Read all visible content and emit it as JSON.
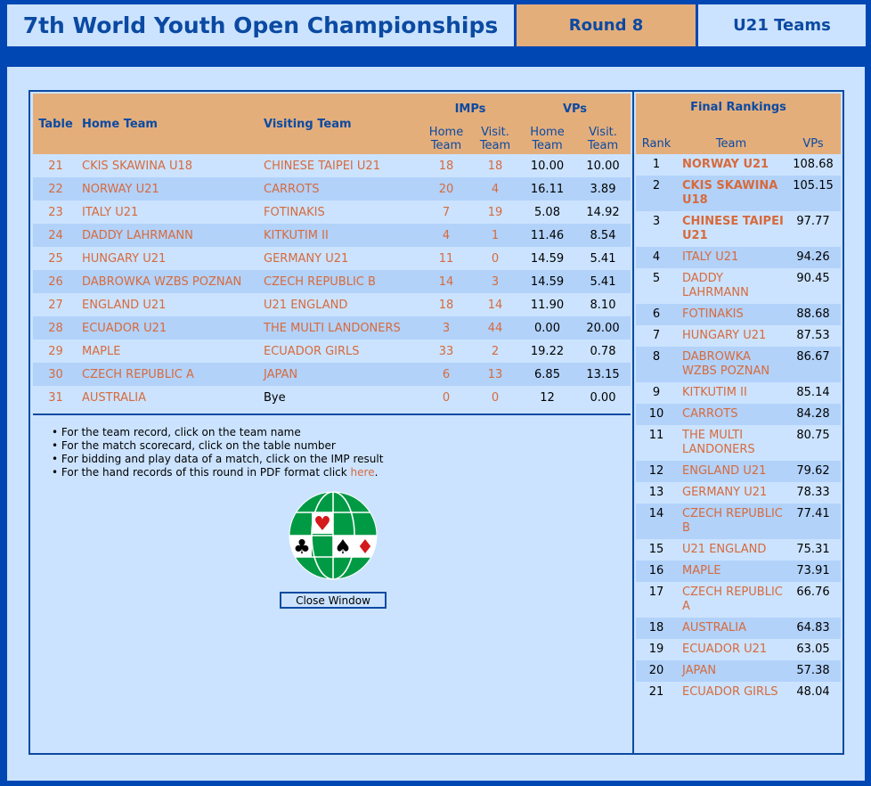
{
  "header": {
    "title": "7th World Youth Open Championships",
    "round": "Round 8",
    "category": "U21 Teams"
  },
  "results": {
    "headers": {
      "table": "Table",
      "home_team": "Home Team",
      "visiting_team": "Visiting Team",
      "imps": "IMPs",
      "vps": "VPs",
      "home_line1": "Home",
      "home_line2": "Team",
      "visit_line1": "Visit.",
      "visit_line2": "Team"
    },
    "rows": [
      {
        "table": "21",
        "home": "CKIS SKAWINA U18",
        "visit": "CHINESE TAIPEI U21",
        "imp_h": "18",
        "imp_v": "18",
        "vp_h": "10.00",
        "vp_v": "10.00"
      },
      {
        "table": "22",
        "home": "NORWAY U21",
        "visit": "CARROTS",
        "imp_h": "20",
        "imp_v": "4",
        "vp_h": "16.11",
        "vp_v": "3.89"
      },
      {
        "table": "23",
        "home": "ITALY U21",
        "visit": "FOTINAKIS",
        "imp_h": "7",
        "imp_v": "19",
        "vp_h": "5.08",
        "vp_v": "14.92"
      },
      {
        "table": "24",
        "home": "DADDY LAHRMANN",
        "visit": "KITKUTIM II",
        "imp_h": "4",
        "imp_v": "1",
        "vp_h": "11.46",
        "vp_v": "8.54"
      },
      {
        "table": "25",
        "home": "HUNGARY U21",
        "visit": "GERMANY U21",
        "imp_h": "11",
        "imp_v": "0",
        "vp_h": "14.59",
        "vp_v": "5.41"
      },
      {
        "table": "26",
        "home": "DABROWKA WZBS POZNAN",
        "visit": "CZECH REPUBLIC B",
        "imp_h": "14",
        "imp_v": "3",
        "vp_h": "14.59",
        "vp_v": "5.41"
      },
      {
        "table": "27",
        "home": "ENGLAND U21",
        "visit": "U21 ENGLAND",
        "imp_h": "18",
        "imp_v": "14",
        "vp_h": "11.90",
        "vp_v": "8.10"
      },
      {
        "table": "28",
        "home": "ECUADOR U21",
        "visit": "THE MULTI LANDONERS",
        "imp_h": "3",
        "imp_v": "44",
        "vp_h": "0.00",
        "vp_v": "20.00"
      },
      {
        "table": "29",
        "home": "MAPLE",
        "visit": "ECUADOR GIRLS",
        "imp_h": "33",
        "imp_v": "2",
        "vp_h": "19.22",
        "vp_v": "0.78"
      },
      {
        "table": "30",
        "home": "CZECH REPUBLIC A",
        "visit": "JAPAN",
        "imp_h": "6",
        "imp_v": "13",
        "vp_h": "6.85",
        "vp_v": "13.15"
      },
      {
        "table": "31",
        "home": "AUSTRALIA",
        "visit": "Bye",
        "imp_h": "0",
        "imp_v": "0",
        "vp_h": "12",
        "vp_v": "0.00"
      }
    ]
  },
  "notes": {
    "note1": "For the team record, click on the team name",
    "note2": "For the match scorecard, click on the table number",
    "note3": "For bidding and play data of a match, click on the IMP result",
    "note4_prefix": "For the hand records of this round in PDF format click ",
    "note4_link": "here",
    "note4_suffix": "."
  },
  "close_button": "Close Window",
  "rankings": {
    "title": "Final Rankings",
    "headers": {
      "rank": "Rank",
      "team": "Team",
      "vps": "VPs"
    },
    "rows": [
      {
        "rank": "1",
        "team": "NORWAY U21",
        "vps": "108.68"
      },
      {
        "rank": "2",
        "team": "CKIS SKAWINA U18",
        "vps": "105.15"
      },
      {
        "rank": "3",
        "team": "CHINESE TAIPEI U21",
        "vps": "97.77"
      },
      {
        "rank": "4",
        "team": "ITALY U21",
        "vps": "94.26"
      },
      {
        "rank": "5",
        "team": "DADDY LAHRMANN",
        "vps": "90.45"
      },
      {
        "rank": "6",
        "team": "FOTINAKIS",
        "vps": "88.68"
      },
      {
        "rank": "7",
        "team": "HUNGARY U21",
        "vps": "87.53"
      },
      {
        "rank": "8",
        "team": "DABROWKA WZBS POZNAN",
        "vps": "86.67"
      },
      {
        "rank": "9",
        "team": "KITKUTIM II",
        "vps": "85.14"
      },
      {
        "rank": "10",
        "team": "CARROTS",
        "vps": "84.28"
      },
      {
        "rank": "11",
        "team": "THE MULTI LANDONERS",
        "vps": "80.75"
      },
      {
        "rank": "12",
        "team": "ENGLAND U21",
        "vps": "79.62"
      },
      {
        "rank": "13",
        "team": "GERMANY U21",
        "vps": "78.33"
      },
      {
        "rank": "14",
        "team": "CZECH REPUBLIC B",
        "vps": "77.41"
      },
      {
        "rank": "15",
        "team": "U21 ENGLAND",
        "vps": "75.31"
      },
      {
        "rank": "16",
        "team": "MAPLE",
        "vps": "73.91"
      },
      {
        "rank": "17",
        "team": "CZECH REPUBLIC A",
        "vps": "66.76"
      },
      {
        "rank": "18",
        "team": "AUSTRALIA",
        "vps": "64.83"
      },
      {
        "rank": "19",
        "team": "ECUADOR U21",
        "vps": "63.05"
      },
      {
        "rank": "20",
        "team": "JAPAN",
        "vps": "57.38"
      },
      {
        "rank": "21",
        "team": "ECUADOR GIRLS",
        "vps": "48.04"
      }
    ]
  },
  "colors": {
    "link": "#d76a3c",
    "header_blue": "#0b4aa2",
    "header_orange": "#e4ae7b",
    "background_blue": "#0047b3",
    "panel_light": "#cbe3ff",
    "row_alt": "#b2d2fa"
  },
  "logo": {
    "icon": "world-bridge-federation-logo-icon"
  }
}
